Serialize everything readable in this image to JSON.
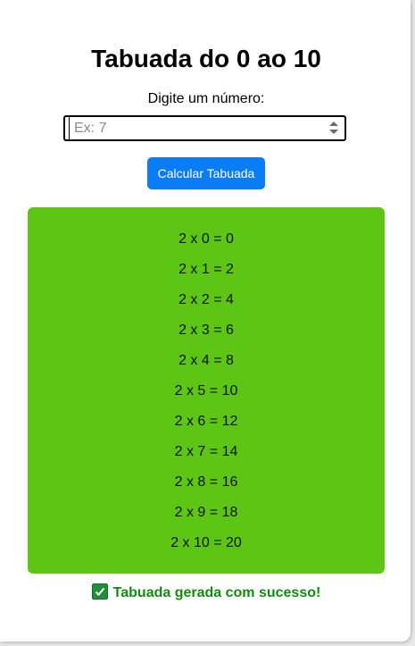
{
  "header": {
    "title": "Tabuada do 0 ao 10"
  },
  "form": {
    "label": "Digite um número:",
    "input_value": "",
    "input_placeholder": "Ex: 7",
    "button_label": "Calcular Tabuada"
  },
  "results": {
    "rows": [
      "2 x 0 = 0",
      "2 x 1 = 2",
      "2 x 2 = 4",
      "2 x 3 = 6",
      "2 x 4 = 8",
      "2 x 5 = 10",
      "2 x 6 = 12",
      "2 x 7 = 14",
      "2 x 8 = 16",
      "2 x 9 = 18",
      "2 x 10 = 20"
    ],
    "background_color": "#5dc614"
  },
  "status": {
    "icon": "check-icon",
    "message": "Tabuada gerada com sucesso!",
    "color": "#138a13"
  },
  "colors": {
    "button": "#0a7cf5",
    "success": "#138a13"
  }
}
